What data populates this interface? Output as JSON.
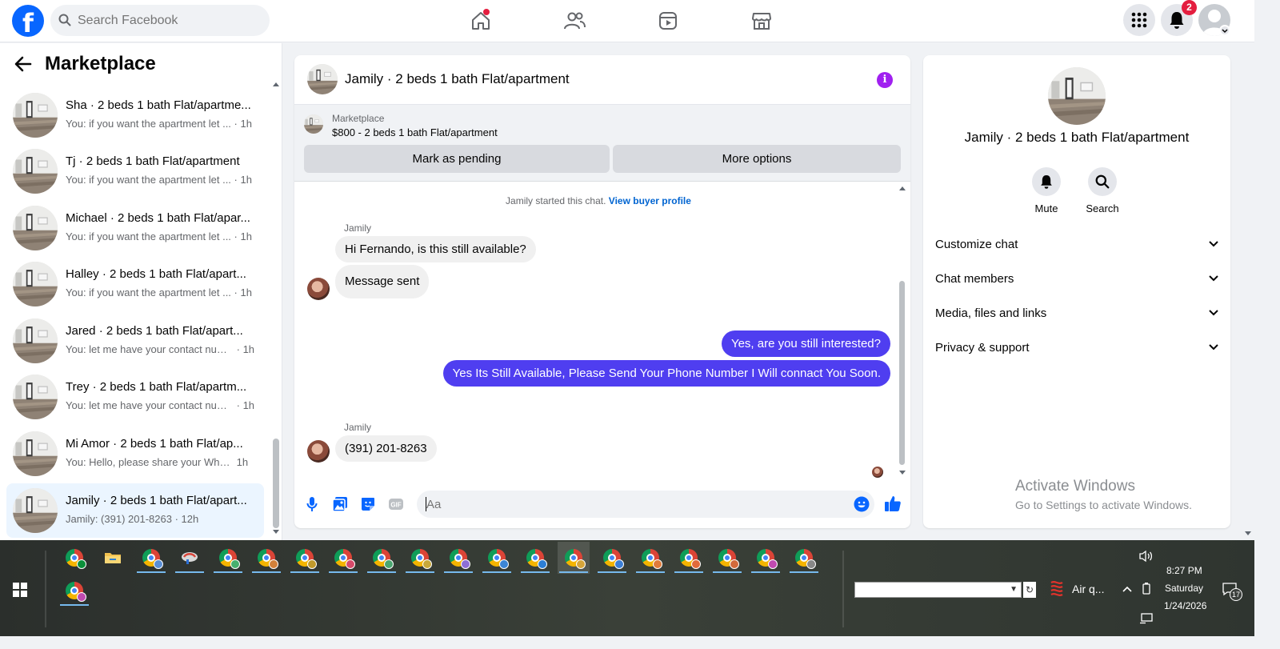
{
  "topbar": {
    "logo_letter": "f",
    "search_placeholder": "Search Facebook",
    "notification_count": "2"
  },
  "sidebar": {
    "title": "Marketplace",
    "conversations": [
      {
        "name": "Sha · 2 beds 1 bath Flat/apartme...",
        "snippet": "You: if you want the apartment let ...",
        "time": "· 1h"
      },
      {
        "name": "Tj · 2 beds 1 bath Flat/apartment",
        "snippet": "You: if you want the apartment let ...",
        "time": "· 1h"
      },
      {
        "name": "Michael · 2 beds 1 bath Flat/apar...",
        "snippet": "You: if you want the apartment let ...",
        "time": "· 1h"
      },
      {
        "name": "Halley · 2 beds 1 bath Flat/apart...",
        "snippet": "You: if you want the apartment let ...",
        "time": "· 1h"
      },
      {
        "name": "Jared · 2 beds 1 bath Flat/apart...",
        "snippet": "You: let me have your contact num...",
        "time": "· 1h"
      },
      {
        "name": "Trey · 2 beds 1 bath Flat/apartm...",
        "snippet": "You: let me have your contact num...",
        "time": "· 1h"
      },
      {
        "name": "Mi Amor · 2 beds 1 bath Flat/ap...",
        "snippet": "You: Hello, please share your Whats...",
        "time": "1h"
      },
      {
        "name": "Jamily · 2 beds 1 bath Flat/apart...",
        "snippet": "Jamily: (391) 201-8263",
        "time": "· 12h"
      }
    ]
  },
  "chat": {
    "title": "Jamily · 2 beds 1 bath Flat/apartment",
    "listing_label": "Marketplace",
    "listing_price": "$800 - 2 beds 1 bath Flat/apartment",
    "mark_pending_label": "Mark as pending",
    "more_options_label": "More options",
    "started_text": "Jamily started this chat.",
    "view_profile_link": "View buyer profile",
    "sender_name": "Jamily",
    "messages": {
      "in1": "Hi Fernando, is this still available?",
      "in2": "Message sent",
      "out1": "Yes, are you still interested?",
      "out2": "Yes Its Still Available, Please Send Your Phone Number I Will connact You Soon.",
      "in3": "(391) 201-8263"
    },
    "composer_placeholder": "Aa"
  },
  "right_panel": {
    "title": "Jamily · 2 beds 1 bath Flat/apartment",
    "mute_label": "Mute",
    "search_label": "Search",
    "sections": [
      "Customize chat",
      "Chat members",
      "Media, files and links",
      "Privacy & support"
    ]
  },
  "watermark": {
    "line1": "Activate Windows",
    "line2": "Go to Settings to activate Windows."
  },
  "taskbar": {
    "weather_label": "Air q...",
    "time": "8:27 PM",
    "day": "Saturday",
    "date": "1/24/2026",
    "notification_count": "17"
  },
  "colors": {
    "brand": "#0866ff",
    "outgoing_bubble": "#4f3ef0",
    "badge": "#e41e3f",
    "info": "#a020f0"
  }
}
